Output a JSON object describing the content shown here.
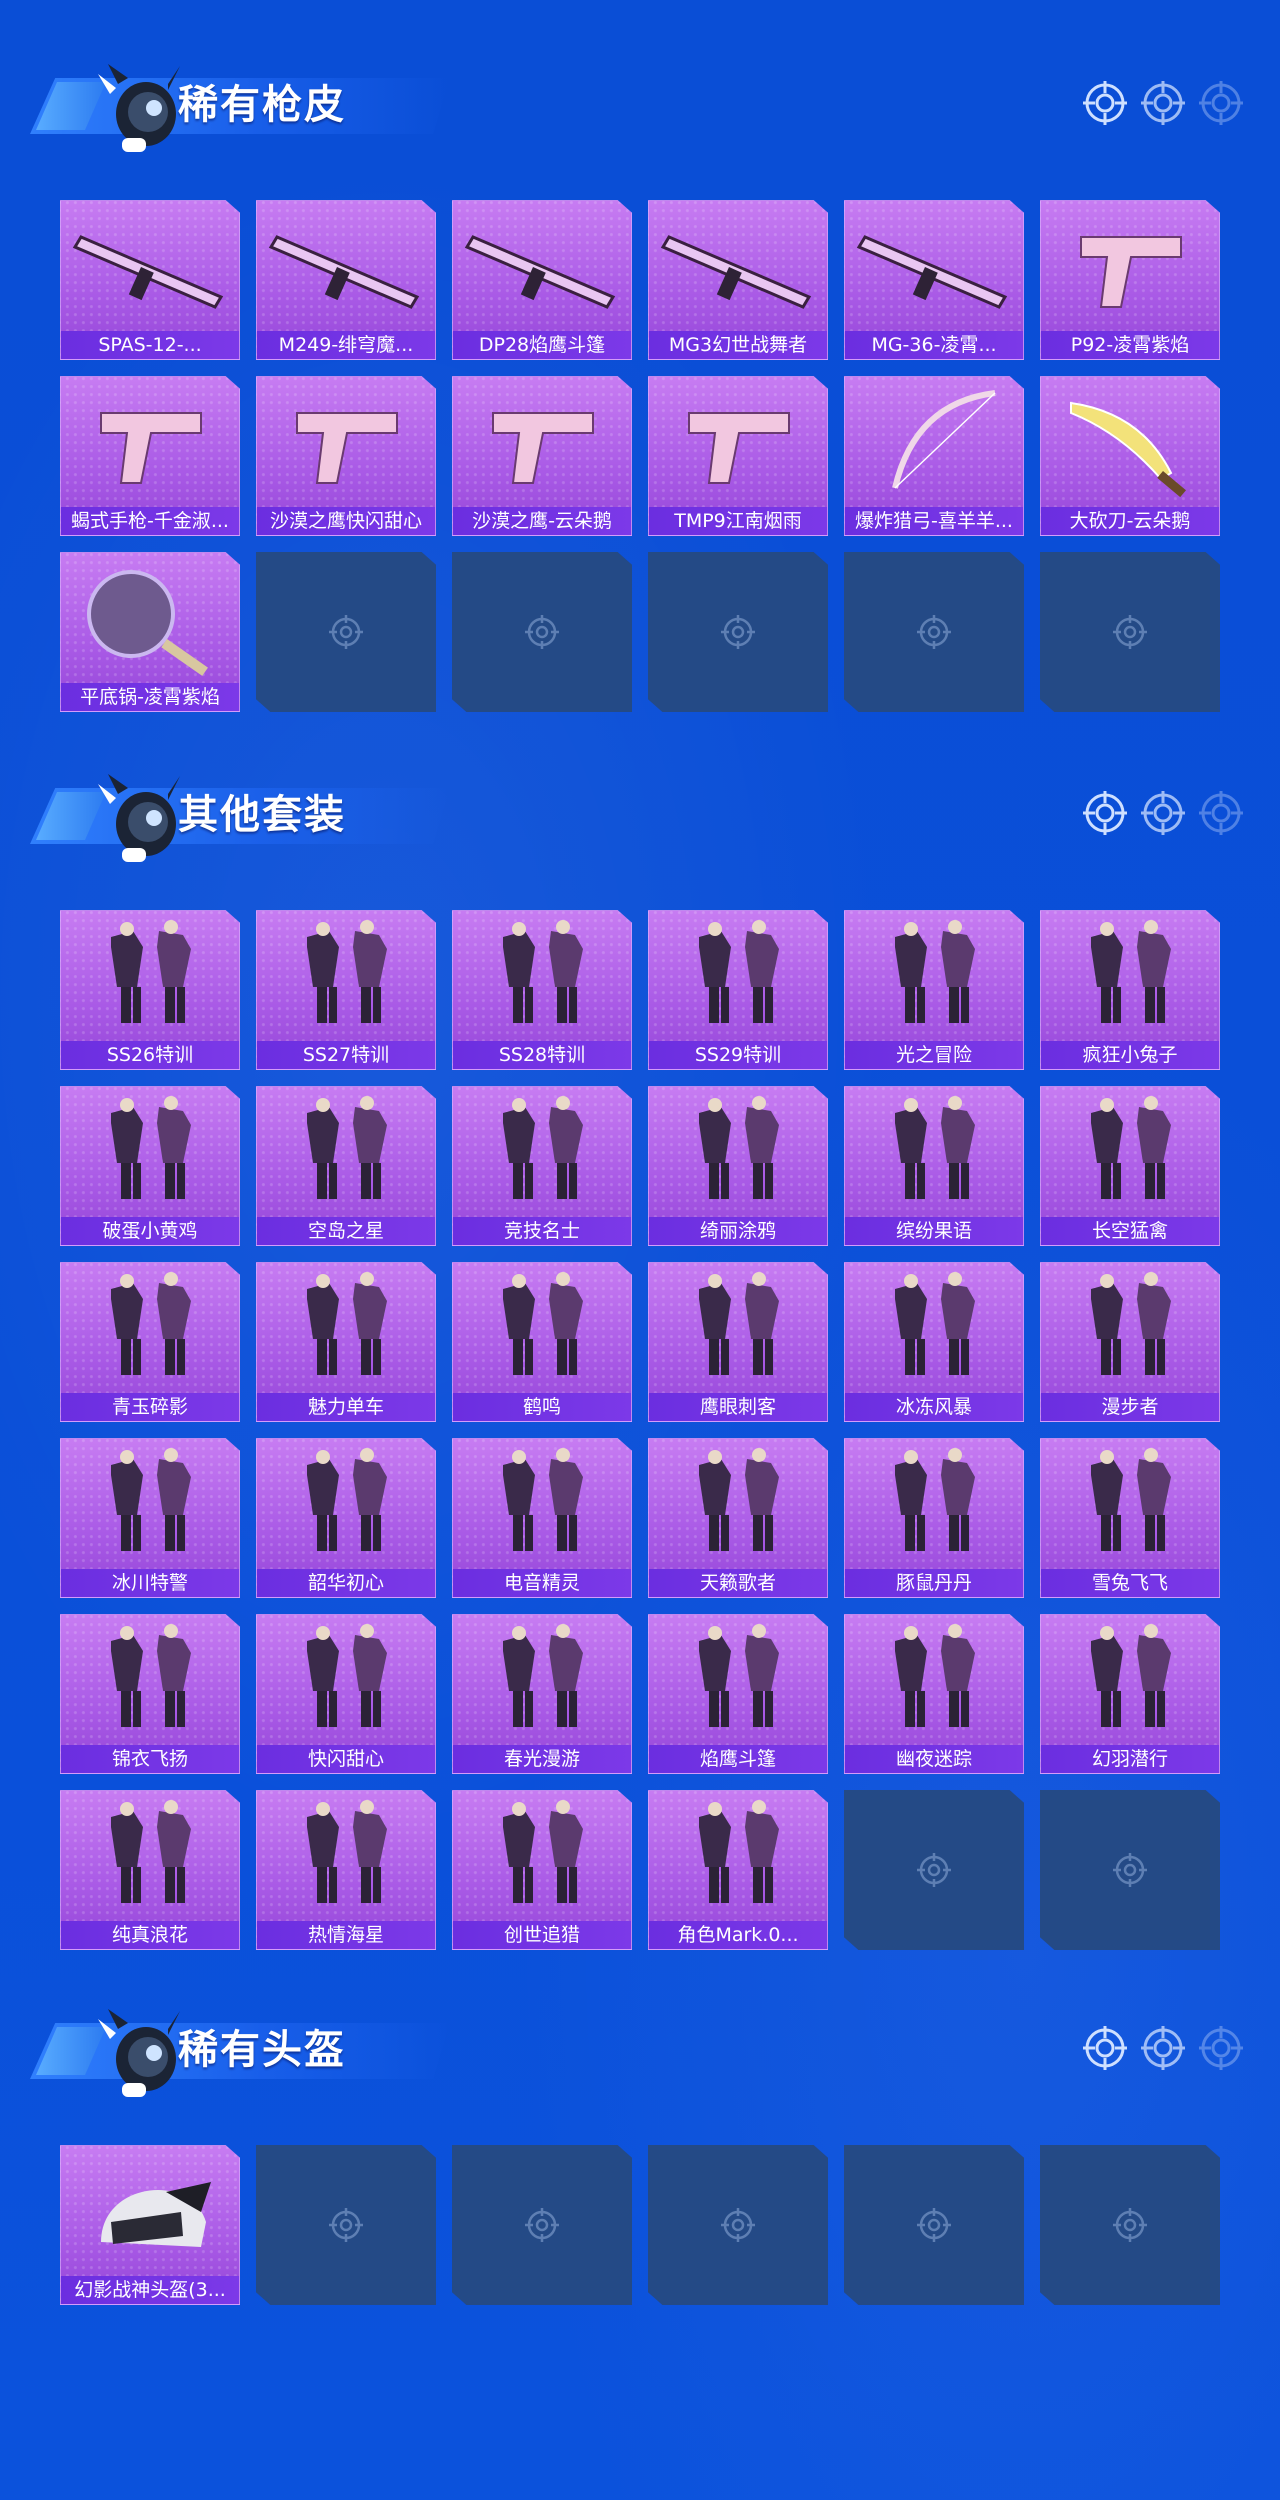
{
  "colors": {
    "background": "#0a4ed6",
    "card_purple": "#a95ae6",
    "label_bar": "#6b2ee0",
    "empty_slot": "#244a86"
  },
  "sections": [
    {
      "title": "稀有枪皮",
      "items": [
        {
          "label": "SPAS-12-...",
          "icon": "shotgun-icon"
        },
        {
          "label": "M249-绯穹魔...",
          "icon": "machine-gun-icon"
        },
        {
          "label": "DP28焰鹰斗篷",
          "icon": "machine-gun-icon"
        },
        {
          "label": "MG3幻世战舞者",
          "icon": "machine-gun-icon"
        },
        {
          "label": "MG-36-凌霄...",
          "icon": "rifle-icon"
        },
        {
          "label": "P92-凌霄紫焰",
          "icon": "pistol-icon"
        },
        {
          "label": "蝎式手枪-千金淑...",
          "icon": "smg-icon"
        },
        {
          "label": "沙漠之鹰快闪甜心",
          "icon": "pistol-icon"
        },
        {
          "label": "沙漠之鹰-云朵鹅",
          "icon": "pistol-icon"
        },
        {
          "label": "TMP9江南烟雨",
          "icon": "smg-icon"
        },
        {
          "label": "爆炸猎弓-喜羊羊...",
          "icon": "bow-icon"
        },
        {
          "label": "大砍刀-云朵鹅",
          "icon": "machete-icon"
        },
        {
          "label": "平底锅-凌霄紫焰",
          "icon": "pan-icon"
        }
      ],
      "total_slots": 18
    },
    {
      "title": "其他套装",
      "items": [
        {
          "label": "SS26特训",
          "icon": "outfit-icon"
        },
        {
          "label": "SS27特训",
          "icon": "outfit-icon"
        },
        {
          "label": "SS28特训",
          "icon": "outfit-icon"
        },
        {
          "label": "SS29特训",
          "icon": "outfit-icon"
        },
        {
          "label": "光之冒险",
          "icon": "outfit-icon"
        },
        {
          "label": "疯狂小兔子",
          "icon": "outfit-icon"
        },
        {
          "label": "破蛋小黄鸡",
          "icon": "outfit-icon"
        },
        {
          "label": "空岛之星",
          "icon": "outfit-icon"
        },
        {
          "label": "竞技名士",
          "icon": "outfit-icon"
        },
        {
          "label": "绮丽涂鸦",
          "icon": "outfit-icon"
        },
        {
          "label": "缤纷果语",
          "icon": "outfit-icon"
        },
        {
          "label": "长空猛禽",
          "icon": "outfit-icon"
        },
        {
          "label": "青玉碎影",
          "icon": "outfit-icon"
        },
        {
          "label": "魅力单车",
          "icon": "outfit-icon"
        },
        {
          "label": "鹤鸣",
          "icon": "outfit-icon"
        },
        {
          "label": "鹰眼刺客",
          "icon": "outfit-icon"
        },
        {
          "label": "冰冻风暴",
          "icon": "outfit-icon"
        },
        {
          "label": "漫步者",
          "icon": "outfit-icon"
        },
        {
          "label": "冰川特警",
          "icon": "outfit-icon"
        },
        {
          "label": "韶华初心",
          "icon": "outfit-icon"
        },
        {
          "label": "电音精灵",
          "icon": "outfit-icon"
        },
        {
          "label": "天籁歌者",
          "icon": "outfit-icon"
        },
        {
          "label": "豚鼠丹丹",
          "icon": "outfit-icon"
        },
        {
          "label": "雪兔飞飞",
          "icon": "outfit-icon"
        },
        {
          "label": "锦衣飞扬",
          "icon": "outfit-icon"
        },
        {
          "label": "快闪甜心",
          "icon": "outfit-icon"
        },
        {
          "label": "春光漫游",
          "icon": "outfit-icon"
        },
        {
          "label": "焰鹰斗篷",
          "icon": "outfit-icon"
        },
        {
          "label": "幽夜迷踪",
          "icon": "outfit-icon"
        },
        {
          "label": "幻羽潜行",
          "icon": "outfit-icon"
        },
        {
          "label": "纯真浪花",
          "icon": "outfit-icon"
        },
        {
          "label": "热情海星",
          "icon": "outfit-icon"
        },
        {
          "label": "创世追猎",
          "icon": "outfit-icon"
        },
        {
          "label": "角色Mark.0...",
          "icon": "character-icon"
        }
      ],
      "total_slots": 36
    },
    {
      "title": "稀有头盔",
      "items": [
        {
          "label": "幻影战神头盔(3...",
          "icon": "helmet-icon"
        }
      ],
      "total_slots": 6
    }
  ]
}
